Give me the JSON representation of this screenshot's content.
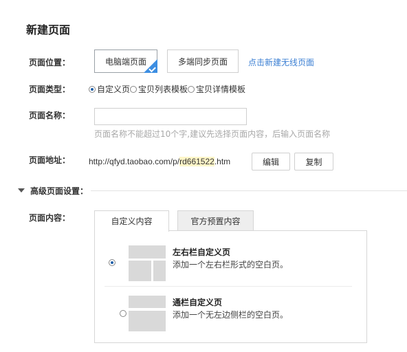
{
  "page_title": "新建页面",
  "position": {
    "label": "页面位置：",
    "pc_button": "电脑端页面",
    "multi_button": "多端同步页面",
    "wireless_link": "点击新建无线页面"
  },
  "type": {
    "label": "页面类型：",
    "options": [
      "自定义页",
      "宝贝列表模板",
      "宝贝详情模板"
    ]
  },
  "name": {
    "label": "页面名称：",
    "value": "",
    "hint": "页面名称不能超过10个字,建议先选择页面内容，后输入页面名称"
  },
  "address": {
    "label": "页面地址：",
    "url_prefix": "http://qfyd.taobao.com/p/",
    "url_id": "rd661522",
    "url_suffix": ".htm",
    "edit_button": "编辑",
    "copy_button": "复制"
  },
  "advanced": {
    "label": "高级页面设置："
  },
  "content": {
    "label": "页面内容：",
    "tabs": [
      "自定义内容",
      "官方预置内容"
    ],
    "layouts": [
      {
        "title": "左右栏自定义页",
        "desc": "添加一个左右栏形式的空白页。"
      },
      {
        "title": "通栏自定义页",
        "desc": "添加一个无左边侧栏的空白页。"
      }
    ]
  }
}
